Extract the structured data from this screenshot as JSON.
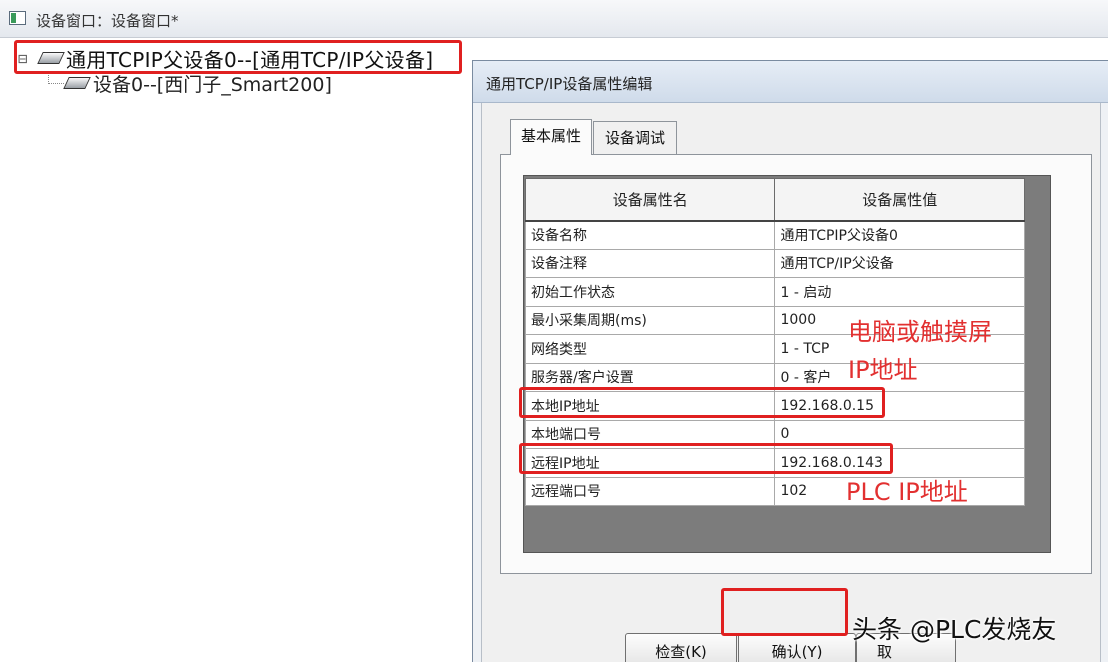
{
  "window": {
    "title": "设备窗口：设备窗口*"
  },
  "tree": {
    "expander": "⊟",
    "parent_label": "通用TCPIP父设备0--[通用TCP/IP父设备]",
    "child_label": "设备0--[西门子_Smart200]"
  },
  "dialog": {
    "title": "通用TCP/IP设备属性编辑",
    "tabs": [
      {
        "label": "基本属性"
      },
      {
        "label": "设备调试"
      }
    ],
    "table": {
      "headers": [
        "设备属性名",
        "设备属性值"
      ],
      "rows": [
        {
          "name": "设备名称",
          "value": "通用TCPIP父设备0"
        },
        {
          "name": "设备注释",
          "value": "通用TCP/IP父设备"
        },
        {
          "name": "初始工作状态",
          "value": "1 - 启动"
        },
        {
          "name": "最小采集周期(ms)",
          "value": "1000"
        },
        {
          "name": "网络类型",
          "value": "1 - TCP"
        },
        {
          "name": "服务器/客户设置",
          "value": "0 - 客户"
        },
        {
          "name": "本地IP地址",
          "value": "192.168.0.15"
        },
        {
          "name": "本地端口号",
          "value": "0"
        },
        {
          "name": "远程IP地址",
          "value": "192.168.0.143"
        },
        {
          "name": "远程端口号",
          "value": "102"
        }
      ]
    },
    "buttons": {
      "check": "检查(K)",
      "ok": "确认(Y)",
      "cancel": "取"
    }
  },
  "annotations": {
    "local_ip_line1": "电脑或触摸屏",
    "local_ip_line2": "IP地址",
    "remote_ip": "PLC IP地址"
  },
  "watermark": "头条 @PLC发烧友",
  "colors": {
    "highlight": "#e02020",
    "annotation_text": "#e23030"
  }
}
